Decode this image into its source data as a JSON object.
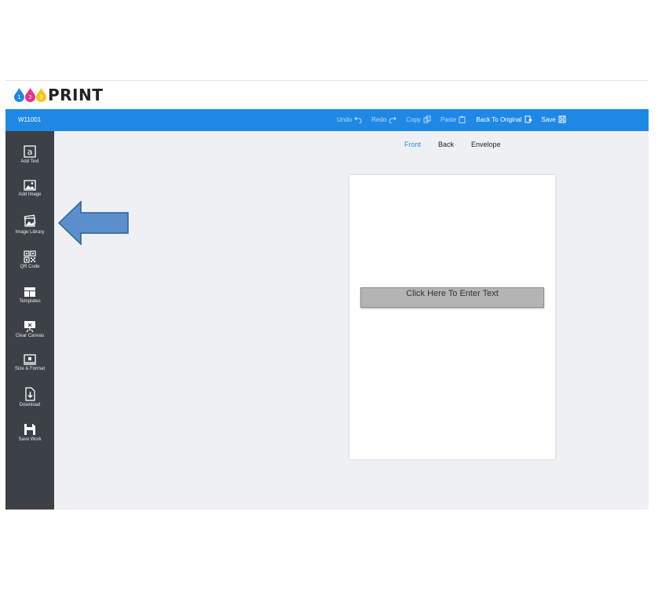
{
  "logo": {
    "digits": [
      "1",
      "2",
      "3"
    ],
    "text": "PRINT"
  },
  "topbar": {
    "doc_id": "W11001",
    "tools": [
      {
        "label": "Undo",
        "icon": "undo-icon"
      },
      {
        "label": "Redo",
        "icon": "redo-icon"
      },
      {
        "label": "Copy",
        "icon": "copy-icon"
      },
      {
        "label": "Paste",
        "icon": "paste-icon"
      },
      {
        "label": "Back To Original",
        "icon": "back-to-original-icon"
      },
      {
        "label": "Save",
        "icon": "save-icon"
      }
    ]
  },
  "sidebar": {
    "items": [
      {
        "label": "Add Text",
        "icon": "add-text-icon"
      },
      {
        "label": "Add Image",
        "icon": "add-image-icon"
      },
      {
        "label": "Image Library",
        "icon": "image-library-icon"
      },
      {
        "label": "QR Code",
        "icon": "qr-code-icon"
      },
      {
        "label": "Templates",
        "icon": "templates-icon"
      },
      {
        "label": "Clear Canvas",
        "icon": "clear-canvas-icon"
      },
      {
        "label": "Size & Format",
        "icon": "size-format-icon"
      },
      {
        "label": "Download",
        "icon": "download-icon"
      },
      {
        "label": "Save Work",
        "icon": "save-work-icon"
      }
    ]
  },
  "tabs": [
    {
      "label": "Front",
      "active": true
    },
    {
      "label": "Back",
      "active": false
    },
    {
      "label": "Envelope",
      "active": false
    }
  ],
  "canvas": {
    "text_placeholder": "Click Here To Enter Text"
  },
  "colors": {
    "accent": "#1f88e5",
    "sidebar": "#3c4047",
    "workspace": "#eff0f4",
    "arrow": "#5b8fcb",
    "drop_blue": "#1f88e5",
    "drop_magenta": "#e8318a",
    "drop_yellow": "#f5c518"
  }
}
